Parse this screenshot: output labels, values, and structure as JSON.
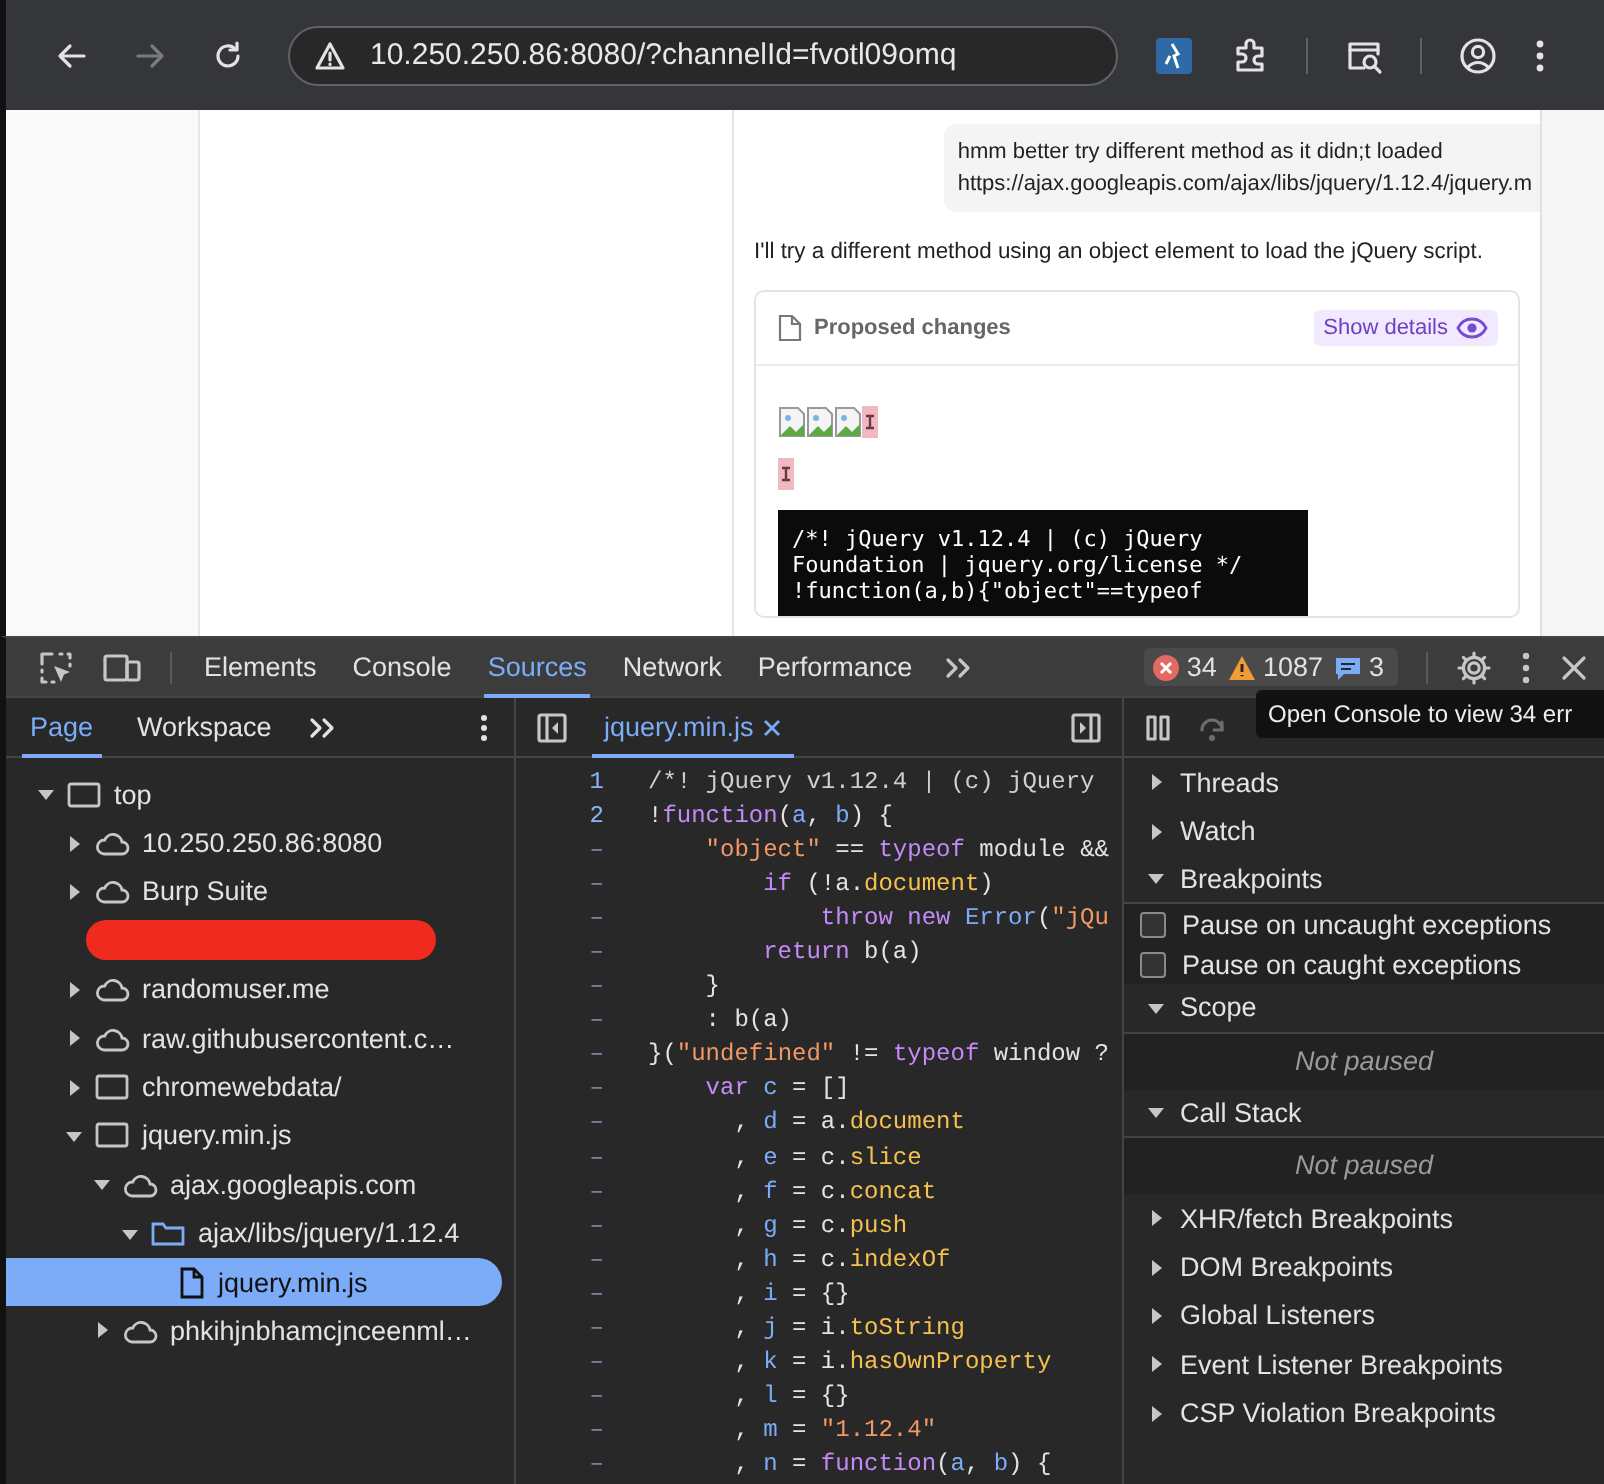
{
  "browser": {
    "nav_buttons": [
      {
        "kind": "back",
        "disabled": false
      },
      {
        "kind": "forward",
        "disabled": true
      },
      {
        "kind": "reload",
        "disabled": false
      }
    ],
    "address": "10.250.250.86:8080/?channelId=fvotl09omq"
  },
  "chat": {
    "user_message": [
      "hmm better try different method as it didn;t loaded",
      "https://ajax.googleapis.com/ajax/libs/jquery/1.12.4/jquery.m"
    ],
    "reply": "I'll try a different method using an object element to load the jQuery script.",
    "card": {
      "title": "Proposed changes",
      "button": "Show details",
      "preview_rows": [
        {
          "items": [
            {
              "kind": "broken-image"
            },
            {
              "kind": "broken-image"
            },
            {
              "kind": "broken-image"
            },
            {
              "kind": "marker"
            }
          ]
        },
        {
          "items": [
            {
              "kind": "marker"
            }
          ]
        }
      ],
      "code_block": [
        "/*! jQuery v1.12.4 | (c) jQuery",
        "Foundation | jquery.org/license */",
        "!function(a,b){\"object\"==typeof"
      ]
    }
  },
  "devtools": {
    "tabs": [
      {
        "label": "Elements",
        "selected": false
      },
      {
        "label": "Console",
        "selected": false
      },
      {
        "label": "Sources",
        "selected": true
      },
      {
        "label": "Network",
        "selected": false
      },
      {
        "label": "Performance",
        "selected": false
      }
    ],
    "counters": [
      {
        "kind": "error",
        "count": "34"
      },
      {
        "kind": "warning",
        "count": "1087"
      },
      {
        "kind": "info",
        "count": "3"
      }
    ],
    "tooltip": "Open Console to view 34 err",
    "navigator_tabs": [
      {
        "label": "Page",
        "selected": true
      },
      {
        "label": "Workspace",
        "selected": false
      }
    ],
    "tree": [
      {
        "kind": "frame",
        "label": "top",
        "expanded": true,
        "selected": false,
        "children": [
          {
            "kind": "cloud",
            "label": "10.250.250.86:8080",
            "expanded": false,
            "selected": false
          },
          {
            "kind": "cloud",
            "label": "Burp Suite",
            "expanded": false,
            "selected": false
          },
          {
            "kind": "redacted"
          },
          {
            "kind": "cloud",
            "label": "randomuser.me",
            "expanded": false,
            "selected": false
          },
          {
            "kind": "cloud",
            "label": "raw.githubusercontent.c…",
            "expanded": false,
            "selected": false
          },
          {
            "kind": "frame",
            "label": "chromewebdata/",
            "expanded": false,
            "selected": false
          },
          {
            "kind": "frame",
            "label": "jquery.min.js",
            "expanded": true,
            "selected": false,
            "children": [
              {
                "kind": "cloud",
                "label": "ajax.googleapis.com",
                "expanded": true,
                "selected": false,
                "children": [
                  {
                    "kind": "folder",
                    "label": "ajax/libs/jquery/1.12.4",
                    "expanded": true,
                    "selected": false,
                    "children": [
                      {
                        "kind": "file",
                        "label": "jquery.min.js",
                        "selected": true
                      }
                    ]
                  }
                ]
              },
              {
                "kind": "cloud",
                "label": "phkihjnbhamcjnceenml…",
                "expanded": false,
                "selected": false
              }
            ]
          }
        ]
      }
    ],
    "editor_tabs": [
      {
        "label": "jquery.min.js",
        "selected": true
      }
    ],
    "code_lines": [
      {
        "number": "1",
        "tokens": [
          {
            "kind": "comment",
            "text": "/*! jQuery v1.12.4 | (c) jQuery"
          }
        ]
      },
      {
        "number": "2",
        "tokens": [
          {
            "kind": "plain",
            "text": "!"
          },
          {
            "kind": "keyword",
            "text": "function"
          },
          {
            "kind": "plain",
            "text": "("
          },
          {
            "kind": "variable",
            "text": "a"
          },
          {
            "kind": "plain",
            "text": ", "
          },
          {
            "kind": "variable",
            "text": "b"
          },
          {
            "kind": "plain",
            "text": ") {"
          }
        ]
      },
      {
        "number": "–",
        "tokens": [
          {
            "kind": "string",
            "text": "    \"object\""
          },
          {
            "kind": "plain",
            "text": " == "
          },
          {
            "kind": "keyword",
            "text": "typeof"
          },
          {
            "kind": "plain",
            "text": " module &&"
          }
        ]
      },
      {
        "number": "–",
        "tokens": [
          {
            "kind": "keyword",
            "text": "        if"
          },
          {
            "kind": "plain",
            "text": " (!a."
          },
          {
            "kind": "property",
            "text": "document"
          },
          {
            "kind": "plain",
            "text": ")"
          }
        ]
      },
      {
        "number": "–",
        "tokens": [
          {
            "kind": "keyword",
            "text": "            throw new "
          },
          {
            "kind": "variable",
            "text": "Error"
          },
          {
            "kind": "plain",
            "text": "("
          },
          {
            "kind": "string",
            "text": "\"jQu"
          }
        ]
      },
      {
        "number": "–",
        "tokens": [
          {
            "kind": "keyword",
            "text": "        return"
          },
          {
            "kind": "plain",
            "text": " b(a)"
          }
        ]
      },
      {
        "number": "–",
        "tokens": [
          {
            "kind": "plain",
            "text": "    }"
          }
        ]
      },
      {
        "number": "–",
        "tokens": [
          {
            "kind": "plain",
            "text": "    : b(a)"
          }
        ]
      },
      {
        "number": "–",
        "tokens": [
          {
            "kind": "plain",
            "text": "}("
          },
          {
            "kind": "string",
            "text": "\"undefined\""
          },
          {
            "kind": "plain",
            "text": " != "
          },
          {
            "kind": "keyword",
            "text": "typeof"
          },
          {
            "kind": "plain",
            "text": " window ?"
          }
        ]
      },
      {
        "number": "–",
        "tokens": [
          {
            "kind": "keyword",
            "text": "    var "
          },
          {
            "kind": "variable",
            "text": "c"
          },
          {
            "kind": "plain",
            "text": " = []"
          }
        ]
      },
      {
        "number": "–",
        "tokens": [
          {
            "kind": "plain",
            "text": "      , "
          },
          {
            "kind": "variable",
            "text": "d"
          },
          {
            "kind": "plain",
            "text": " = a."
          },
          {
            "kind": "property",
            "text": "document"
          }
        ]
      },
      {
        "number": "–",
        "tokens": [
          {
            "kind": "plain",
            "text": "      , "
          },
          {
            "kind": "variable",
            "text": "e"
          },
          {
            "kind": "plain",
            "text": " = c."
          },
          {
            "kind": "property",
            "text": "slice"
          }
        ]
      },
      {
        "number": "–",
        "tokens": [
          {
            "kind": "plain",
            "text": "      , "
          },
          {
            "kind": "variable",
            "text": "f"
          },
          {
            "kind": "plain",
            "text": " = c."
          },
          {
            "kind": "property",
            "text": "concat"
          }
        ]
      },
      {
        "number": "–",
        "tokens": [
          {
            "kind": "plain",
            "text": "      , "
          },
          {
            "kind": "variable",
            "text": "g"
          },
          {
            "kind": "plain",
            "text": " = c."
          },
          {
            "kind": "property",
            "text": "push"
          }
        ]
      },
      {
        "number": "–",
        "tokens": [
          {
            "kind": "plain",
            "text": "      , "
          },
          {
            "kind": "variable",
            "text": "h"
          },
          {
            "kind": "plain",
            "text": " = c."
          },
          {
            "kind": "property",
            "text": "indexOf"
          }
        ]
      },
      {
        "number": "–",
        "tokens": [
          {
            "kind": "plain",
            "text": "      , "
          },
          {
            "kind": "variable",
            "text": "i"
          },
          {
            "kind": "plain",
            "text": " = {}"
          }
        ]
      },
      {
        "number": "–",
        "tokens": [
          {
            "kind": "plain",
            "text": "      , "
          },
          {
            "kind": "variable",
            "text": "j"
          },
          {
            "kind": "plain",
            "text": " = i."
          },
          {
            "kind": "property",
            "text": "toString"
          }
        ]
      },
      {
        "number": "–",
        "tokens": [
          {
            "kind": "plain",
            "text": "      , "
          },
          {
            "kind": "variable",
            "text": "k"
          },
          {
            "kind": "plain",
            "text": " = i."
          },
          {
            "kind": "property",
            "text": "hasOwnProperty"
          }
        ]
      },
      {
        "number": "–",
        "tokens": [
          {
            "kind": "plain",
            "text": "      , "
          },
          {
            "kind": "variable",
            "text": "l"
          },
          {
            "kind": "plain",
            "text": " = {}"
          }
        ]
      },
      {
        "number": "–",
        "tokens": [
          {
            "kind": "plain",
            "text": "      , "
          },
          {
            "kind": "variable",
            "text": "m"
          },
          {
            "kind": "plain",
            "text": " = "
          },
          {
            "kind": "string",
            "text": "\"1.12.4\""
          }
        ]
      },
      {
        "number": "–",
        "tokens": [
          {
            "kind": "plain",
            "text": "      , "
          },
          {
            "kind": "variable",
            "text": "n"
          },
          {
            "kind": "plain",
            "text": " = "
          },
          {
            "kind": "keyword",
            "text": "function"
          },
          {
            "kind": "plain",
            "text": "("
          },
          {
            "kind": "variable",
            "text": "a"
          },
          {
            "kind": "plain",
            "text": ", "
          },
          {
            "kind": "variable",
            "text": "b"
          },
          {
            "kind": "plain",
            "text": ") {"
          }
        ]
      }
    ],
    "debugger": [
      {
        "kind": "section",
        "label": "Threads",
        "expanded": false
      },
      {
        "kind": "section",
        "label": "Watch",
        "expanded": false
      },
      {
        "kind": "section",
        "label": "Breakpoints",
        "expanded": true
      },
      {
        "kind": "checkbox",
        "label": "Pause on uncaught exceptions",
        "checked": false
      },
      {
        "kind": "checkbox",
        "label": "Pause on caught exceptions",
        "checked": false
      },
      {
        "kind": "section",
        "label": "Scope",
        "expanded": true
      },
      {
        "kind": "message",
        "label": "Not paused"
      },
      {
        "kind": "section",
        "label": "Call Stack",
        "expanded": true
      },
      {
        "kind": "message",
        "label": "Not paused"
      },
      {
        "kind": "section",
        "label": "XHR/fetch Breakpoints",
        "expanded": false
      },
      {
        "kind": "section",
        "label": "DOM Breakpoints",
        "expanded": false
      },
      {
        "kind": "section",
        "label": "Global Listeners",
        "expanded": false
      },
      {
        "kind": "section",
        "label": "Event Listener Breakpoints",
        "expanded": false
      },
      {
        "kind": "section",
        "label": "CSP Violation Breakpoints",
        "expanded": false
      }
    ]
  }
}
